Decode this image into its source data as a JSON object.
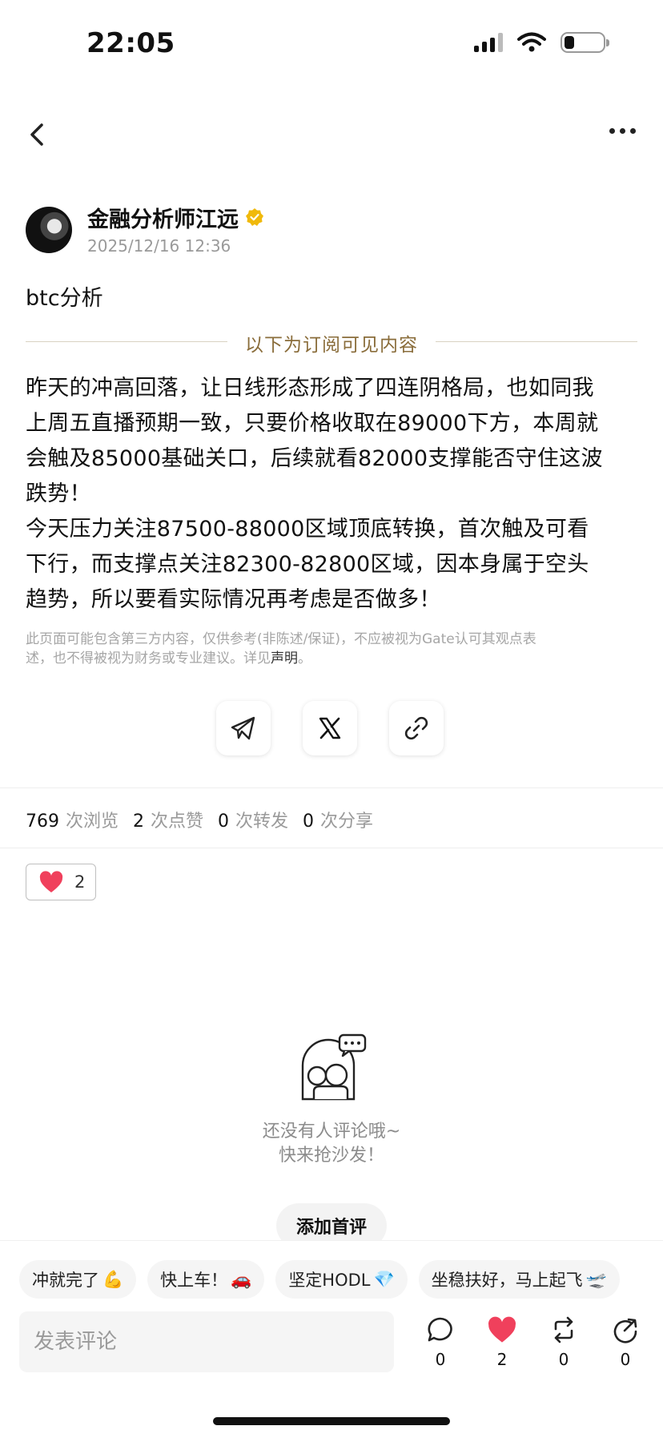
{
  "status_bar": {
    "time": "22:05"
  },
  "author": {
    "name": "金融分析师江远",
    "date": "2025/12/16 12:36"
  },
  "post": {
    "title": "btc分析",
    "subscriber_divider": "以下为订阅可见内容",
    "body_lines": [
      "昨天的冲高回落，让日线形态形成了四连阴格局，也如同我",
      "上周五直播预期一致，只要价格收取在89000下方，本周就",
      "会触及85000基础关口，后续就看82000支撑能否守住这波",
      "跌势！",
      "今天压力关注87500-88000区域顶底转换，首次触及可看",
      "下行，而支撑点关注82300-82800区域，因本身属于空头",
      "趋势，所以要看实际情况再考虑是否做多！"
    ],
    "disclaimer_line1": "此页面可能包含第三方内容，仅供参考(非陈述/保证)，不应被视为Gate认可其观点表",
    "disclaimer_line2": "述，也不得被视为财务或专业建议。详见",
    "disclaimer_link": "声明",
    "disclaimer_end": "。"
  },
  "share": {
    "buttons": [
      {
        "icon": "telegram-icon"
      },
      {
        "icon": "x-icon"
      },
      {
        "icon": "link-icon"
      }
    ]
  },
  "stats": {
    "views": "769",
    "views_label": "次浏览",
    "likes": "2",
    "likes_label": "次点赞",
    "reposts": "0",
    "reposts_label": "次转发",
    "shares": "0",
    "shares_label": "次分享"
  },
  "reaction": {
    "icon": "heart-icon",
    "count": "2"
  },
  "comments": {
    "empty_line1": "还没有人评论哦~",
    "empty_line2": "快来抢沙发！",
    "first_comment_button": "添加首评"
  },
  "quick_replies": [
    {
      "text": "冲就完了",
      "emoji": "💪"
    },
    {
      "text": "快上车！",
      "emoji": "🚗"
    },
    {
      "text": "坚定HODL",
      "emoji": "💎"
    },
    {
      "text": "坐稳扶好，马上起飞",
      "emoji": "🛫"
    }
  ],
  "comment_bar": {
    "placeholder": "发表评论",
    "comment_count": "0",
    "like_count": "2",
    "repost_count": "0",
    "share_count": "0"
  },
  "colors": {
    "accent_gold": "#8a6d3b",
    "verified": "#f0b90b",
    "heart": "#f0405c"
  }
}
